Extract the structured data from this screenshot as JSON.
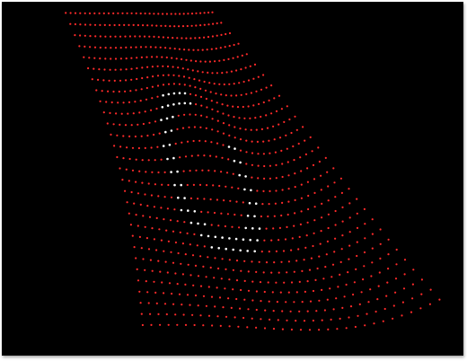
{
  "scene": {
    "background_color": "#000000",
    "frame_color": "#ffffff",
    "mesh": {
      "description_free": true,
      "cols": 34,
      "rows": 30,
      "point_color_primary": "#ff2a2a",
      "point_color_highlight": "#ffffff"
    }
  }
}
